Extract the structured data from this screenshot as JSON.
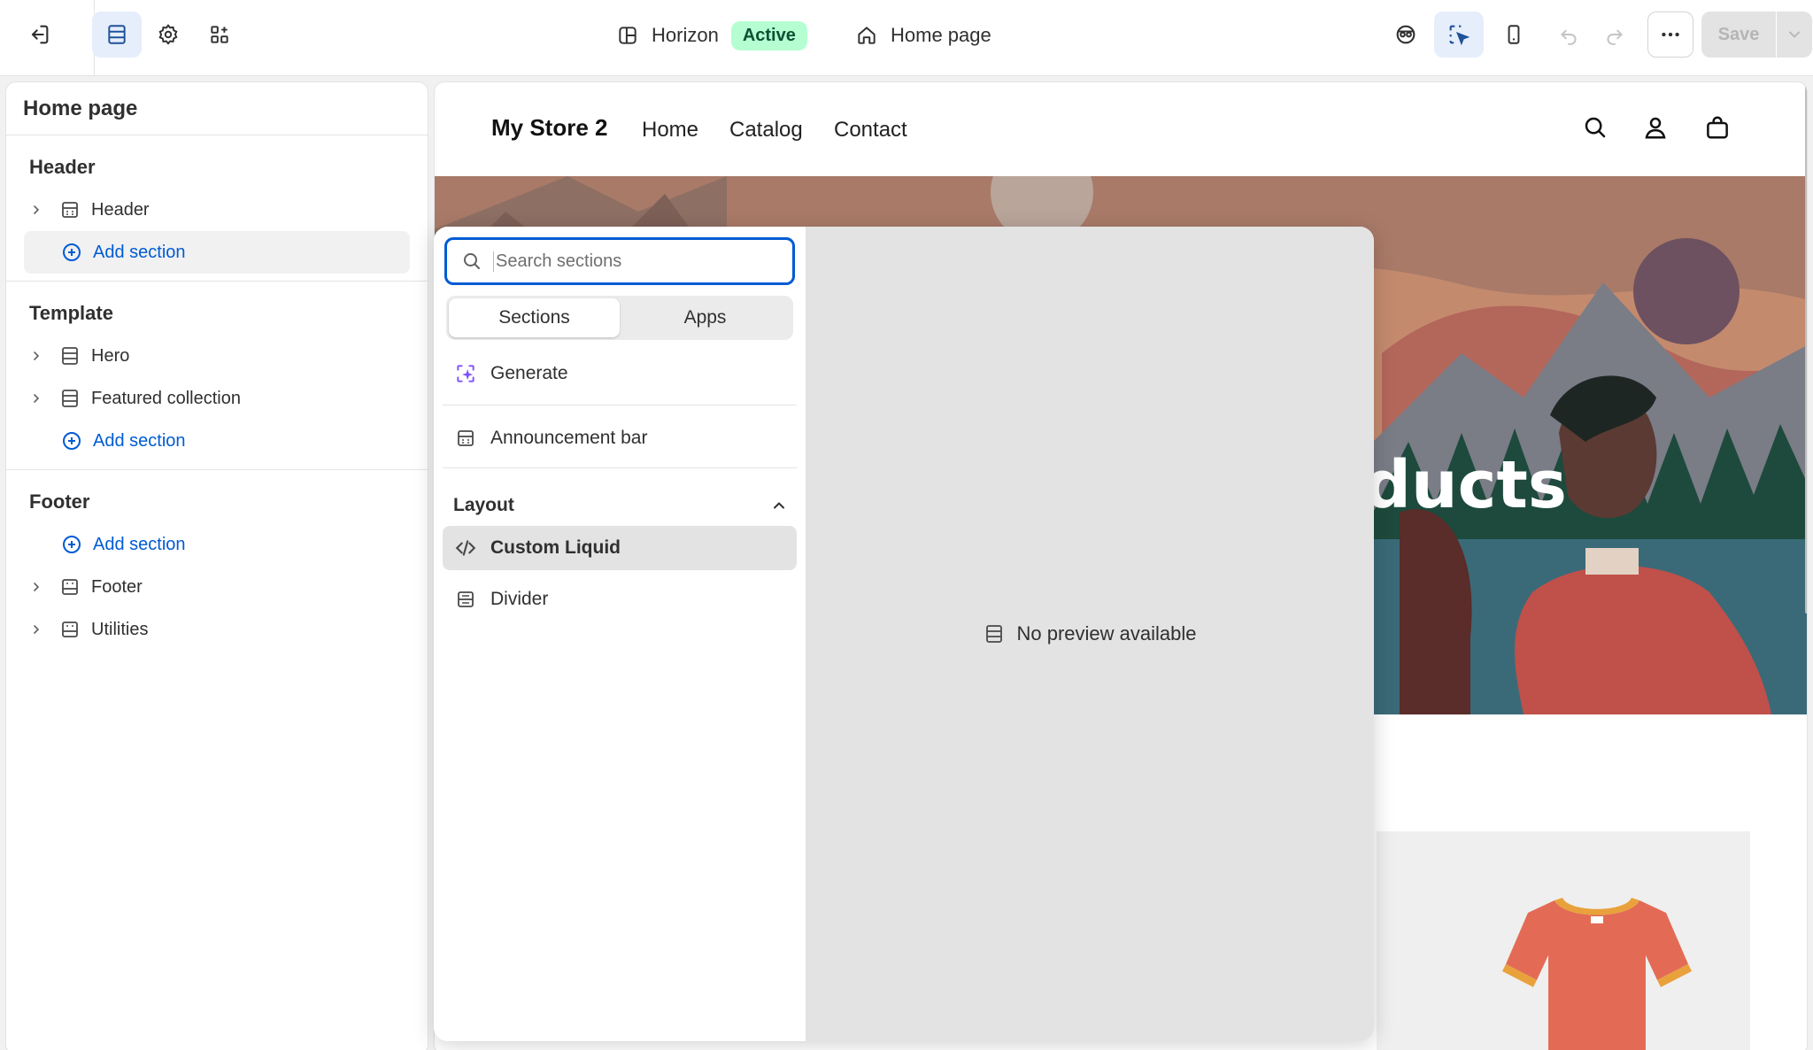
{
  "topbar": {
    "theme_name": "Horizon",
    "theme_status": "Active",
    "page_name": "Home page",
    "save_label": "Save"
  },
  "sidebar": {
    "title": "Home page",
    "groups": [
      {
        "title": "Header",
        "items": [
          "Header"
        ],
        "add_label": "Add section"
      },
      {
        "title": "Template",
        "items": [
          "Hero",
          "Featured collection"
        ],
        "add_label": "Add section"
      },
      {
        "title": "Footer",
        "items": [
          "Footer",
          "Utilities"
        ],
        "add_label": "Add section"
      }
    ]
  },
  "store": {
    "name": "My Store 2",
    "nav": [
      "Home",
      "Catalog",
      "Contact"
    ],
    "hero_text": "ducts"
  },
  "picker": {
    "search_placeholder": "Search sections",
    "tabs": [
      "Sections",
      "Apps"
    ],
    "generate_label": "Generate",
    "announcement_label": "Announcement bar",
    "category_label": "Layout",
    "items": [
      "Custom Liquid",
      "Divider"
    ],
    "preview_text": "No preview available"
  },
  "colors": {
    "accent": "#005bd3",
    "active_badge_bg": "#b4fed2",
    "generate_icon": "#8051ff"
  }
}
